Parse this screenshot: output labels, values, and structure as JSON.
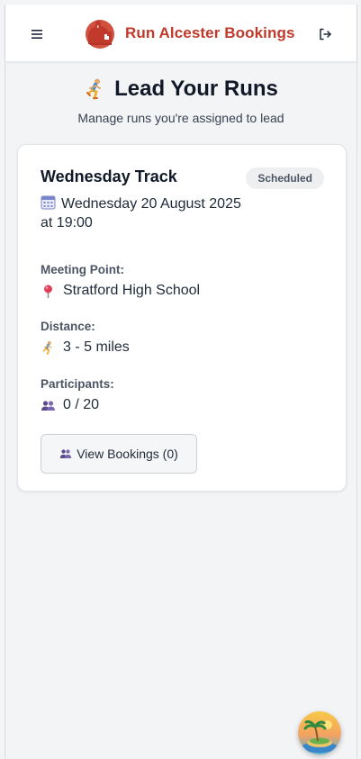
{
  "header": {
    "brand_title": "Run Alcester Bookings",
    "menu_icon": "hamburger-menu-icon",
    "logout_icon": "logout-icon",
    "brand_color": "#c0392b"
  },
  "page": {
    "title": "Lead Your Runs",
    "title_icon": "runner-icon",
    "subtitle": "Manage runs you're assigned to lead"
  },
  "run_card": {
    "title": "Wednesday Track",
    "status": "Scheduled",
    "date_line1": "Wednesday 20 August 2025",
    "date_line2": "at 19:00",
    "meeting_point_label": "Meeting Point:",
    "meeting_point": "Stratford High School",
    "distance_label": "Distance:",
    "distance": "3 - 5 miles",
    "participants_label": "Participants:",
    "participants": "0 / 20",
    "view_bookings_label": "View Bookings (0)"
  },
  "floating_button": {
    "icon": "island-icon"
  }
}
